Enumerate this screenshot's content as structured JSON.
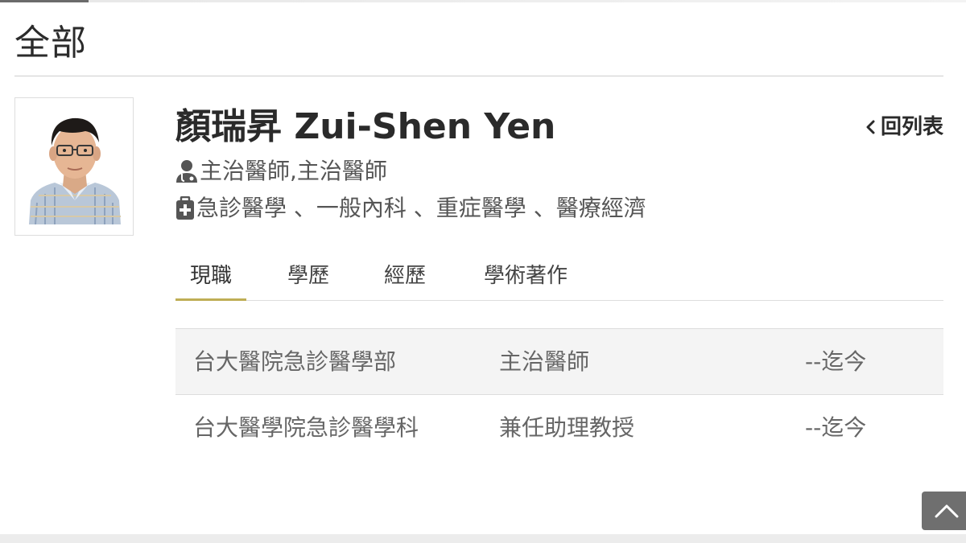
{
  "section": {
    "title": "全部"
  },
  "doctor": {
    "name": "顏瑞昇 Zui-Shen Yen",
    "title_line": "主治醫師,主治醫師",
    "specialties_line": "急診醫學 、一般內科 、重症醫學 、醫療經濟"
  },
  "nav": {
    "back_label": "回列表"
  },
  "tabs": [
    {
      "label": "現職",
      "active": true
    },
    {
      "label": "學歷",
      "active": false
    },
    {
      "label": "經歷",
      "active": false
    },
    {
      "label": "學術著作",
      "active": false
    }
  ],
  "positions": [
    {
      "org": "台大醫院急診醫學部",
      "title": "主治醫師",
      "period": "--迄今"
    },
    {
      "org": "台大醫學院急診醫學科",
      "title": "兼任助理教授",
      "period": "--迄今"
    }
  ],
  "icons": {
    "doctor": "doctor-icon",
    "clinic": "medical-kit-icon",
    "back": "chevron-left-icon",
    "scroll_top": "chevron-up-icon"
  },
  "colors": {
    "tab_active_underline": "#bfae55",
    "scroll_top_bg": "#6f6f6f",
    "row_shade": "#f4f4f4"
  }
}
